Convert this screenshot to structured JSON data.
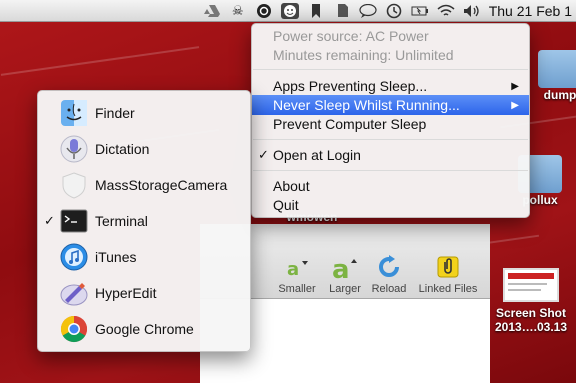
{
  "menubar": {
    "icons": [
      "drive-icon",
      "skull-icon",
      "circle-app-icon",
      "caffeine-icon",
      "bookmark-icon",
      "evernote-icon",
      "chat-icon",
      "time-machine-icon",
      "battery-icon",
      "wifi-icon",
      "volume-icon"
    ],
    "clock": "Thu 21 Feb  1"
  },
  "desktop": {
    "icons": [
      {
        "label": "dump"
      },
      {
        "label": "pollux"
      },
      {
        "label": "wmowen"
      },
      {
        "label": "Screen Shot",
        "sublabel": "2013….03.13"
      }
    ]
  },
  "toolbar": {
    "buttons": [
      {
        "label": "Smaller"
      },
      {
        "label": "Larger"
      },
      {
        "label": "Reload"
      },
      {
        "label": "Linked Files"
      }
    ]
  },
  "main_menu": {
    "power_source": "Power source: AC Power",
    "minutes_remaining": "Minutes remaining: Unlimited",
    "apps_preventing": "Apps Preventing Sleep...",
    "never_sleep": "Never Sleep Whilst Running...",
    "prevent_sleep": "Prevent Computer Sleep",
    "open_at_login": "Open at Login",
    "about": "About",
    "quit": "Quit",
    "check": "✓",
    "arrow": "▶"
  },
  "submenu": {
    "items": [
      {
        "label": "Finder",
        "checked": false
      },
      {
        "label": "Dictation",
        "checked": false
      },
      {
        "label": "MassStorageCamera",
        "checked": false
      },
      {
        "label": "Terminal",
        "checked": true
      },
      {
        "label": "iTunes",
        "checked": false
      },
      {
        "label": "HyperEdit",
        "checked": false
      },
      {
        "label": "Google Chrome",
        "checked": false
      }
    ],
    "check": "✓"
  },
  "colors": {
    "highlight": "#2d65ea",
    "desktop": "#9e1014"
  }
}
